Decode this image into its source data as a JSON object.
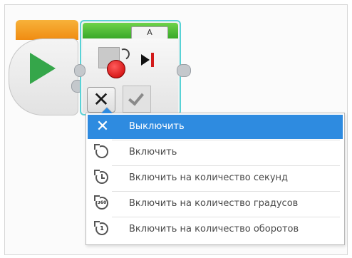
{
  "motor_block": {
    "port_label": "A",
    "mode_symbol": "✕"
  },
  "mode_menu": {
    "items": [
      {
        "label": "Выключить",
        "icon": "off-x-icon",
        "selected": true
      },
      {
        "label": "Включить",
        "icon": "on-rotate-icon",
        "selected": false
      },
      {
        "label": "Включить на количество секунд",
        "icon": "seconds-timer-icon",
        "selected": false
      },
      {
        "label": "Включить на количество градусов",
        "icon": "degrees-icon",
        "selected": false,
        "icon_text": "360"
      },
      {
        "label": "Включить на количество оборотов",
        "icon": "rotations-icon",
        "selected": false,
        "icon_text": "1"
      }
    ]
  },
  "colors": {
    "selection": "#2e8be0",
    "start_header": "#f29a1c",
    "motor_header": "#4cbc35",
    "play": "#35a64a",
    "motor": "#d40000",
    "selected_outline": "#59d2d6"
  }
}
